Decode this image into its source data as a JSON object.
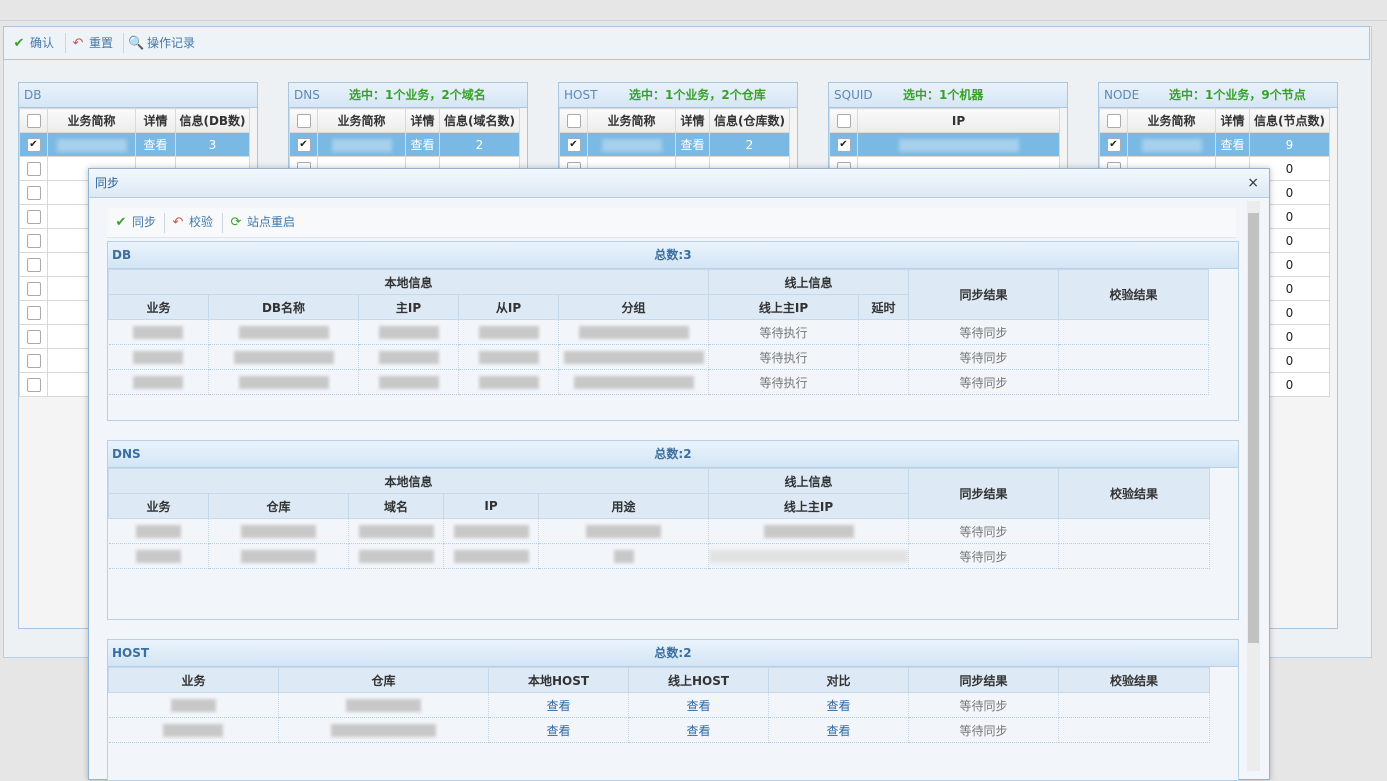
{
  "toolbar": {
    "confirm": "确认",
    "reset": "重置",
    "log": "操作记录"
  },
  "panels": {
    "db": {
      "title": "DB",
      "status": "",
      "headers": [
        "业务简称",
        "详情",
        "信息(DB数)"
      ],
      "link": "查看",
      "rows": [
        "3",
        "",
        "",
        "",
        "",
        "",
        "",
        "",
        "",
        "",
        ""
      ]
    },
    "dns": {
      "title": "DNS",
      "status": "选中：1个业务，2个域名",
      "headers": [
        "业务简称",
        "详情",
        "信息(域名数)"
      ],
      "link": "查看",
      "value": "2"
    },
    "host": {
      "title": "HOST",
      "status": "选中：1个业务，2个仓库",
      "headers": [
        "业务简称",
        "详情",
        "信息(仓库数)"
      ],
      "link": "查看",
      "value": "2"
    },
    "squid": {
      "title": "SQUID",
      "status": "选中：1个机器",
      "headers": [
        "IP"
      ]
    },
    "node": {
      "title": "NODE",
      "status": "选中：1个业务，9个节点",
      "headers": [
        "业务简称",
        "详情",
        "信息(节点数)"
      ],
      "link": "查看",
      "values": [
        "9",
        "0",
        "0",
        "0",
        "0",
        "0",
        "0",
        "0",
        "0",
        "0",
        "0"
      ]
    }
  },
  "dialog": {
    "title": "同步",
    "close": "×",
    "toolbar": {
      "sync": "同步",
      "verify": "校验",
      "restart": "站点重启"
    },
    "db": {
      "title": "DB",
      "total": "总数:3",
      "group_local": "本地信息",
      "group_online": "线上信息",
      "sync_result": "同步结果",
      "verify_result": "校验结果",
      "cols": [
        "业务",
        "DB名称",
        "主IP",
        "从IP",
        "分组",
        "线上主IP",
        "延时"
      ],
      "rows": [
        {
          "online": "等待执行",
          "sync": "等待同步"
        },
        {
          "online": "等待执行",
          "sync": "等待同步"
        },
        {
          "online": "等待执行",
          "sync": "等待同步"
        }
      ]
    },
    "dns": {
      "title": "DNS",
      "total": "总数:2",
      "group_local": "本地信息",
      "group_online": "线上信息",
      "sync_result": "同步结果",
      "verify_result": "校验结果",
      "cols": [
        "业务",
        "仓库",
        "域名",
        "IP",
        "用途",
        "线上主IP"
      ],
      "rows": [
        {
          "sync": "等待同步"
        },
        {
          "sync": "等待同步"
        }
      ]
    },
    "host": {
      "title": "HOST",
      "total": "总数:2",
      "cols": [
        "业务",
        "仓库",
        "本地HOST",
        "线上HOST",
        "对比",
        "同步结果",
        "校验结果"
      ],
      "rows": [
        {
          "local": "查看",
          "online": "查看",
          "compare": "查看",
          "sync": "等待同步"
        },
        {
          "local": "查看",
          "online": "查看",
          "compare": "查看",
          "sync": "等待同步"
        }
      ]
    }
  }
}
